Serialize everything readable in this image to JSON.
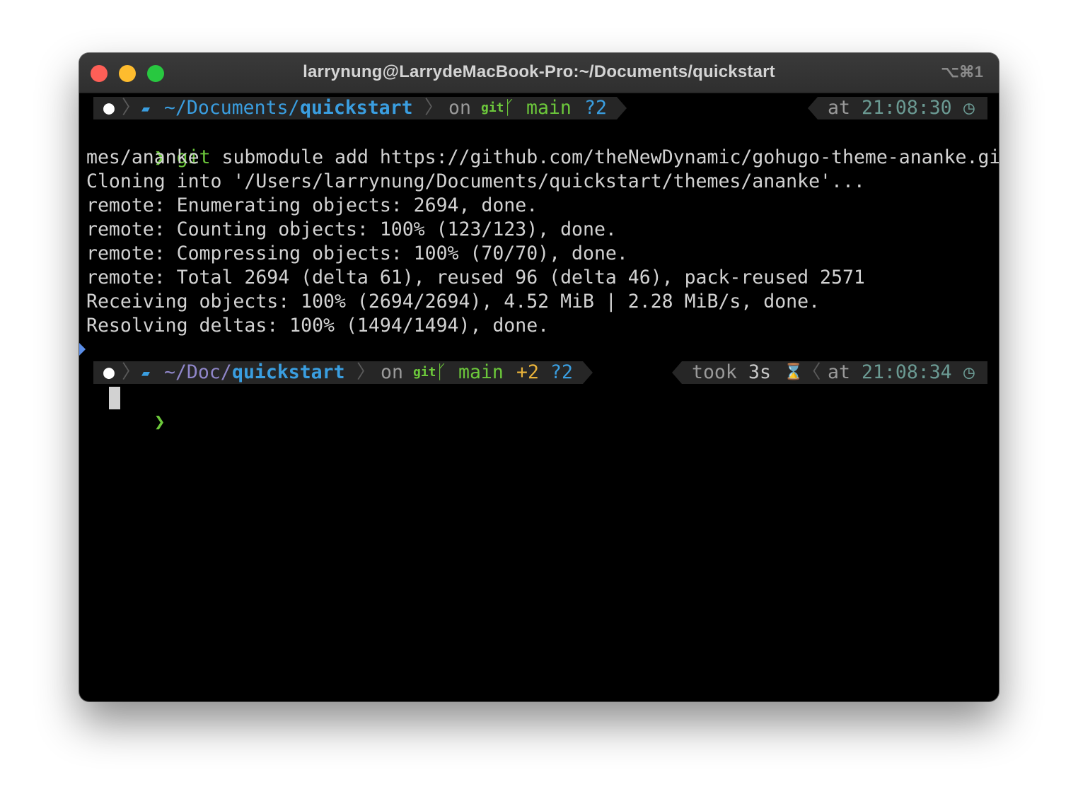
{
  "window": {
    "title": "larrynung@LarrydeMacBook-Pro:~/Documents/quickstart",
    "shortcut": "⌥⌘1"
  },
  "prompt1": {
    "apple": "",
    "path_prefix": "~/Documents/",
    "path_dir": "quickstart",
    "on": "on",
    "git": "git",
    "branch_icon": "ᚴ",
    "branch": "main",
    "untracked": "?2",
    "at": "at",
    "time": "21:08:30",
    "clock_icon": "◷"
  },
  "command": {
    "chevron": "❯",
    "cmd": "git",
    "args_line1": " submodule add https://github.com/theNewDynamic/gohugo-theme-ananke.git the",
    "args_line2": "mes/ananke"
  },
  "output": [
    "Cloning into '/Users/larrynung/Documents/quickstart/themes/ananke'...",
    "remote: Enumerating objects: 2694, done.",
    "remote: Counting objects: 100% (123/123), done.",
    "remote: Compressing objects: 100% (70/70), done.",
    "remote: Total 2694 (delta 61), reused 96 (delta 46), pack-reused 2571",
    "Receiving objects: 100% (2694/2694), 4.52 MiB | 2.28 MiB/s, done.",
    "Resolving deltas: 100% (1494/1494), done."
  ],
  "prompt2": {
    "apple": "",
    "path_prefix": "~/Doc/",
    "path_dir": "quickstart",
    "on": "on",
    "git": "git",
    "branch_icon": "ᚴ",
    "branch": "main",
    "staged": "+2",
    "untracked": "?2",
    "took": "took",
    "duration": "3s",
    "hourglass_icon": "⌛",
    "at": "at",
    "time": "21:08:34",
    "clock_icon": "◷"
  },
  "input": {
    "chevron": "❯",
    "value": ""
  },
  "colors": {
    "background": "#000000",
    "text": "#d2d2d2",
    "prompt_segment": "#262626",
    "path": "#3a9ee0",
    "git_green": "#6cc83b",
    "staged_orange": "#e8b23a",
    "time_teal": "#6b9a93"
  }
}
